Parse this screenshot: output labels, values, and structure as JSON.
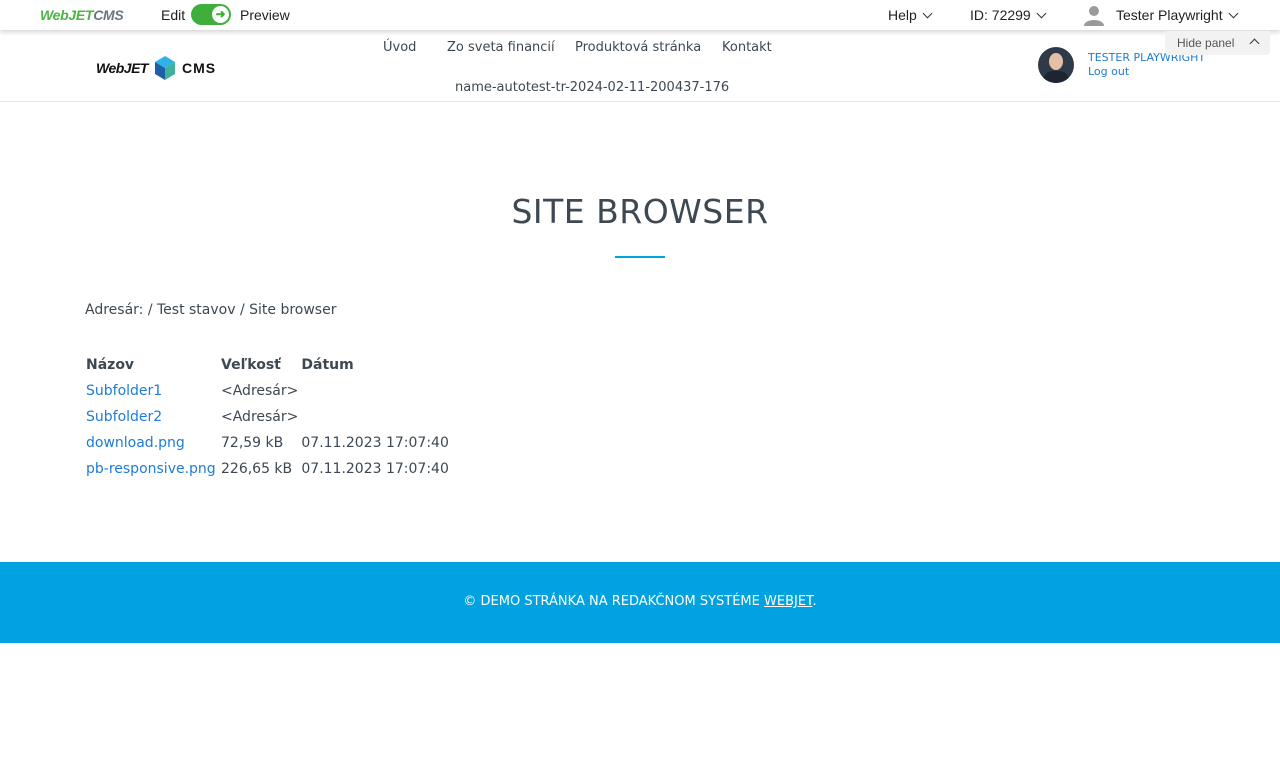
{
  "admin_bar": {
    "logo_green": "WebJET",
    "logo_gray": "CMS",
    "edit_label": "Edit",
    "preview_label": "Preview",
    "help_label": "Help",
    "id_label": "ID: 72299",
    "user_name": "Tester Playwright",
    "toggle_color": "#3fae3a"
  },
  "site_header": {
    "logo_left": "WebJET",
    "logo_right": "CMS",
    "nav": [
      "Úvod",
      "Zo sveta financií",
      "Produktová stránka",
      "Kontakt"
    ],
    "nav_second_row": "name-autotest-tr-2024-02-11-200437-176",
    "user_display": "TESTER PLAYWRIGHT",
    "logout_label": "Log out",
    "hide_panel_label": "Hide panel"
  },
  "main": {
    "title": "SITE BROWSER",
    "breadcrumb": "Adresár: / Test stavov / Site browser",
    "table": {
      "headers": [
        "Názov",
        "Veľkosť",
        "Dátum"
      ],
      "rows": [
        {
          "name": "Subfolder1",
          "size": "<Adresár>",
          "date": ""
        },
        {
          "name": "Subfolder2",
          "size": "<Adresár>",
          "date": ""
        },
        {
          "name": "download.png",
          "size": "72,59 kB",
          "date": "07.11.2023 17:07:40"
        },
        {
          "name": "pb-responsive.png",
          "size": "226,65 kB",
          "date": "07.11.2023 17:07:40"
        }
      ]
    }
  },
  "footer": {
    "text": "© DEMO STRÁNKA NA REDAKČNOM SYSTÉME",
    "link": "WEBJET",
    "trail": ".",
    "color": "#00a3e0"
  },
  "icons": {
    "toggle": "arrow-right-icon",
    "user": "user-icon",
    "chevron": "chevron-down-icon",
    "hide": "chevron-up-icon"
  }
}
